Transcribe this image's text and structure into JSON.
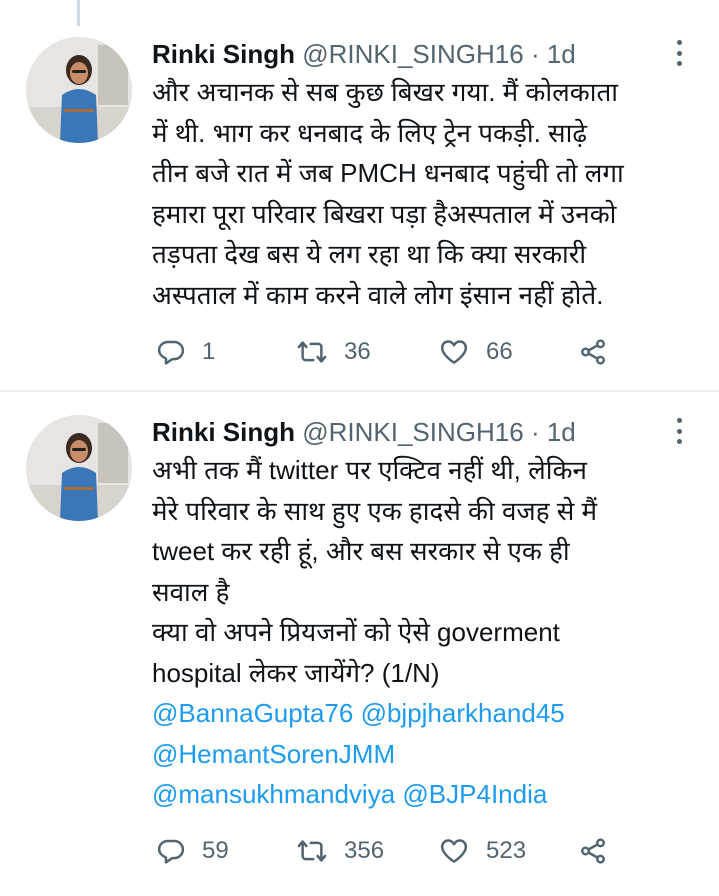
{
  "tweets": [
    {
      "author": {
        "name": "Rinki Singh",
        "handle": "@RINKI_SINGH16",
        "separator": "·",
        "time": "1d"
      },
      "text_lines": [
        "और अचानक से सब कुछ बिखर गया. मैं कोलकाता",
        "में थी. भाग कर धनबाद के लिए ट्रेन पकड़ी. साढ़े",
        "तीन बजे रात में जब PMCH धनबाद पहुंची तो लगा",
        "हमारा पूरा परिवार बिखरा पड़ा हैअस्पताल में उनको",
        "तड़पता देख बस ये लग रहा था कि क्या सरकारी",
        "अस्पताल में काम करने वाले लोग इंसान नहीं होते."
      ],
      "stats": {
        "replies": "1",
        "retweets": "36",
        "likes": "66"
      }
    },
    {
      "author": {
        "name": "Rinki Singh",
        "handle": "@RINKI_SINGH16",
        "separator": "·",
        "time": "1d"
      },
      "text_lines": [
        "अभी तक मैं twitter पर एक्टिव नहीं थी, लेकिन",
        "मेरे परिवार के साथ हुए एक हादसे की वजह से मैं",
        "tweet कर रही हूं, और बस सरकार से एक ही",
        "सवाल है",
        "क्या वो अपने प्रियजनों को ऐसे goverment",
        "hospital लेकर जायेंगे? (1/N)"
      ],
      "mentions": [
        [
          "@BannaGupta76",
          "@bjpjharkhand45"
        ],
        [
          "@HemantSorenJMM"
        ],
        [
          "@mansukhmandviya",
          "@BJP4India"
        ]
      ],
      "stats": {
        "replies": "59",
        "retweets": "356",
        "likes": "523"
      }
    }
  ],
  "icons": {
    "more": "more-vertical-icon",
    "reply": "reply-icon",
    "retweet": "retweet-icon",
    "like": "heart-icon",
    "share": "share-icon"
  },
  "colors": {
    "text": "#0f1419",
    "secondary": "#536471",
    "link": "#1d9bf0",
    "divider": "#eff3f4",
    "thread_line": "#cfd9de"
  }
}
